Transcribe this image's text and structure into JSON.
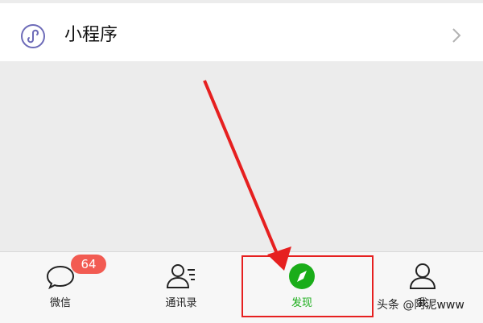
{
  "menu_row": {
    "label": "小程序",
    "icon": "mini-program-icon"
  },
  "tabbar": {
    "tabs": [
      {
        "label": "微信",
        "icon": "chat-bubble-icon",
        "badge": "64",
        "active": false
      },
      {
        "label": "通讯录",
        "icon": "contacts-icon",
        "active": false
      },
      {
        "label": "发现",
        "icon": "compass-icon",
        "active": true
      },
      {
        "label": "我",
        "icon": "person-icon",
        "active": false
      }
    ]
  },
  "watermark": "头条 @阿泥www",
  "colors": {
    "accent": "#1aad19",
    "badge": "#f25b52",
    "annotation": "#e62020",
    "row_icon": "#6d6bb8"
  }
}
